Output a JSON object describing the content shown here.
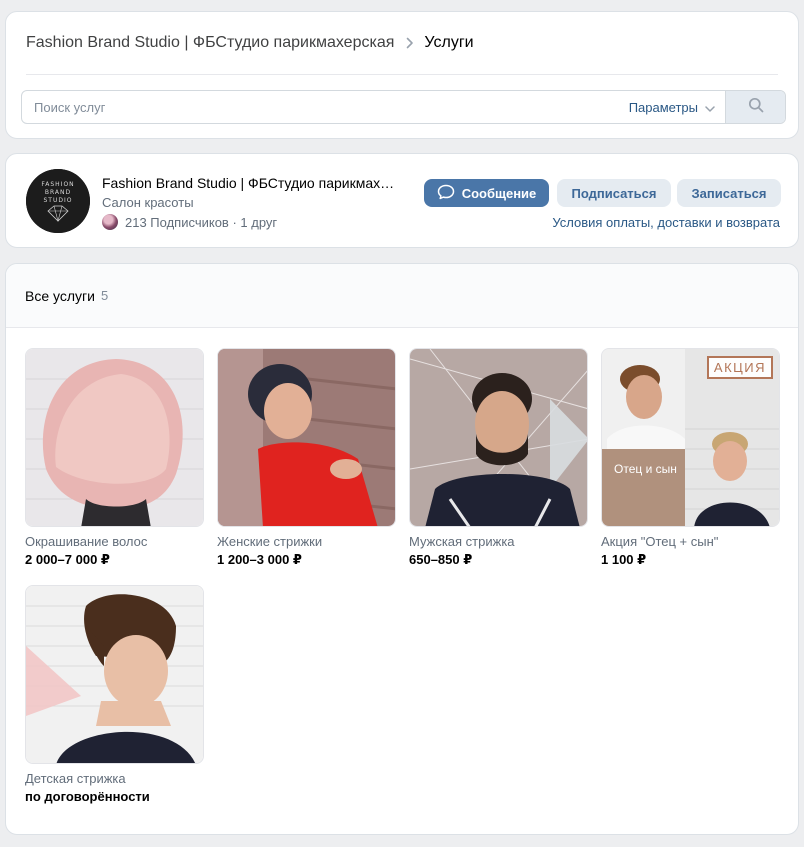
{
  "breadcrumb": {
    "community": "Fashion Brand Studio | ФБСтудио парикмахерская",
    "current": "Услуги"
  },
  "search": {
    "placeholder": "Поиск услуг",
    "params_label": "Параметры"
  },
  "profile": {
    "name": "Fashion Brand Studio | ФБСтудио парикмах…",
    "category": "Салон красоты",
    "subscribers_text": "213 Подписчиков · 1 друг",
    "logo_text": [
      "FASHION",
      "BRAND",
      "STUDIO"
    ],
    "buttons": {
      "message": "Сообщение",
      "subscribe": "Подписаться",
      "book": "Записаться"
    },
    "terms_link": "Условия оплаты, доставки и возврата"
  },
  "services": {
    "title": "Все услуги",
    "count": "5",
    "items": [
      {
        "name": "Окрашивание волос",
        "price": "2 000–7 000 ₽"
      },
      {
        "name": "Женские стрижки",
        "price": "1 200–3 000 ₽"
      },
      {
        "name": "Мужская стрижка",
        "price": "650–850 ₽"
      },
      {
        "name": "Акция \"Отец + сын\"",
        "price": "1 100 ₽",
        "badge": "АКЦИЯ",
        "caption": "Отец и сын"
      },
      {
        "name": "Детская стрижка",
        "price": "по договорённости"
      }
    ]
  },
  "colors": {
    "accent": "#4a76a8",
    "link": "#2a5885",
    "background": "#edeef0"
  }
}
